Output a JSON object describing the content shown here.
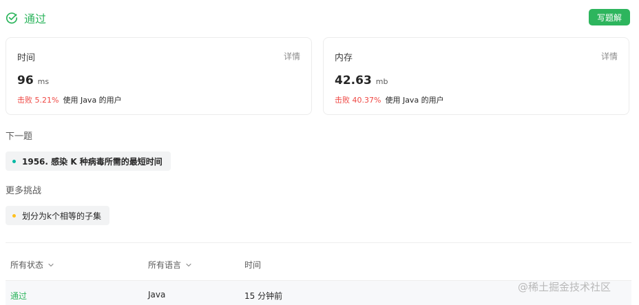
{
  "header": {
    "status_text": "通过",
    "solution_button": "写题解"
  },
  "stats": {
    "runtime": {
      "label": "时间",
      "detail": "详情",
      "value": "96",
      "unit": "ms",
      "beat_prefix": "击败 5.21%",
      "beat_suffix": "使用 Java 的用户"
    },
    "memory": {
      "label": "内存",
      "detail": "详情",
      "value": "42.63",
      "unit": "mb",
      "beat_prefix": "击败 40.37%",
      "beat_suffix": "使用 Java 的用户"
    }
  },
  "next": {
    "label": "下一题",
    "item": "1956. 感染 K 种病毒所需的最短时间"
  },
  "more": {
    "label": "更多挑战",
    "item": "划分为k个相等的子集"
  },
  "filters": {
    "status": "所有状态",
    "language": "所有语言",
    "time": "时间"
  },
  "result": {
    "status": "通过",
    "language": "Java",
    "time": "15 分钟前"
  },
  "watermark": "@稀土掘金技术社区",
  "colors": {
    "success": "#2db55d",
    "fail": "#ef4743",
    "teal_dot": "#00b8a3",
    "yellow_dot": "#ffc01e"
  },
  "icons": {
    "status": "check-circle-icon",
    "dropdown": "chevron-down-icon"
  }
}
